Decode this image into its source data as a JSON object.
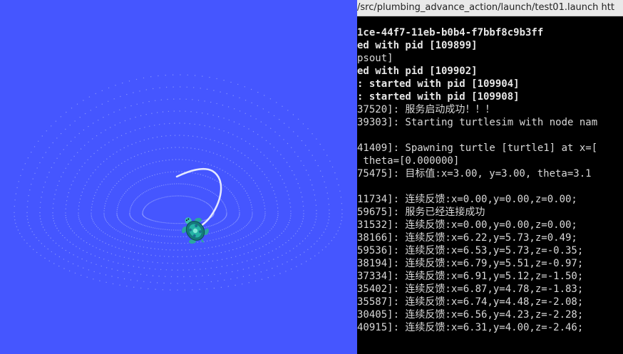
{
  "turtlesim": {
    "background": "#4556ff",
    "turtle": "turtle-icon"
  },
  "terminal": {
    "title": "/src/plumbing_advance_action/launch/test01.launch htt",
    "lines": [
      {
        "text": "1ce-44f7-11eb-b0b4-f7bbf8c9b3ff",
        "bold": true
      },
      {
        "text": "ed with pid [109899]",
        "bold": true
      },
      {
        "text": "psout]",
        "bold": false
      },
      {
        "text": "ed with pid [109902]",
        "bold": true
      },
      {
        "text": ": started with pid [109904]",
        "bold": true
      },
      {
        "text": ": started with pid [109908]",
        "bold": true
      },
      {
        "text": "37520]: 服务启动成功！！！",
        "bold": false
      },
      {
        "text": "39303]: Starting turtlesim with node nam",
        "bold": false
      },
      {
        "text": "",
        "bold": false
      },
      {
        "text": "41409]: Spawning turtle [turtle1] at x=[",
        "bold": false
      },
      {
        "text": " theta=[0.000000]",
        "bold": false
      },
      {
        "text": "75475]: 目标值:x=3.00, y=3.00, theta=3.1",
        "bold": false
      },
      {
        "text": "",
        "bold": false
      },
      {
        "text": "11734]: 连续反馈:x=0.00,y=0.00,z=0.00;",
        "bold": false
      },
      {
        "text": "59675]: 服务已经连接成功",
        "bold": false
      },
      {
        "text": "31532]: 连续反馈:x=0.00,y=0.00,z=0.00;",
        "bold": false
      },
      {
        "text": "38166]: 连续反馈:x=6.22,y=5.73,z=0.49;",
        "bold": false
      },
      {
        "text": "59536]: 连续反馈:x=6.53,y=5.73,z=-0.35;",
        "bold": false
      },
      {
        "text": "38194]: 连续反馈:x=6.79,y=5.51,z=-0.97;",
        "bold": false
      },
      {
        "text": "37334]: 连续反馈:x=6.91,y=5.12,z=-1.50;",
        "bold": false
      },
      {
        "text": "35402]: 连续反馈:x=6.87,y=4.78,z=-1.83;",
        "bold": false
      },
      {
        "text": "35587]: 连续反馈:x=6.74,y=4.48,z=-2.08;",
        "bold": false
      },
      {
        "text": "30405]: 连续反馈:x=6.56,y=4.23,z=-2.28;",
        "bold": false
      },
      {
        "text": "40915]: 连续反馈:x=6.31,y=4.00,z=-2.46;",
        "bold": false
      }
    ]
  }
}
